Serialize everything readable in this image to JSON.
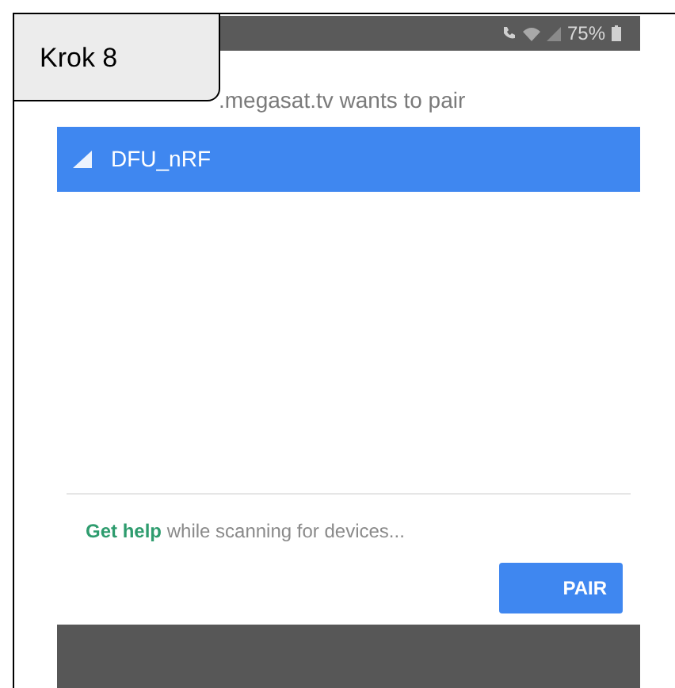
{
  "step_label": "Krok 8",
  "status_bar": {
    "battery": "75%"
  },
  "dialog": {
    "title": ".megasat.tv wants to pair",
    "devices": [
      {
        "name": "DFU_nRF",
        "selected": true
      }
    ],
    "help_link": "Get help",
    "help_text": " while scanning for devices...",
    "buttons": [
      "PAIR"
    ]
  }
}
